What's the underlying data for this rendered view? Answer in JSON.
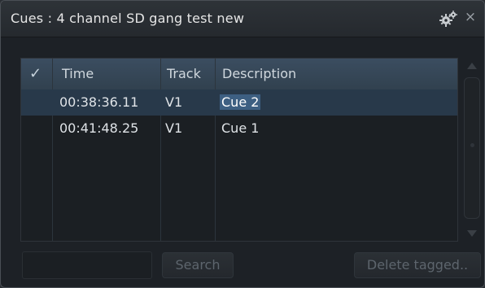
{
  "window": {
    "title": "Cues : 4 channel SD gang test new",
    "close_glyph": "×"
  },
  "table": {
    "columns": {
      "check": "✓",
      "time": "Time",
      "track": "Track",
      "description": "Description"
    },
    "rows": [
      {
        "time": "00:38:36.11",
        "track": "V1",
        "description": "Cue 2",
        "selected": true
      },
      {
        "time": "00:41:48.25",
        "track": "V1",
        "description": "Cue 1",
        "selected": false
      }
    ]
  },
  "footer": {
    "search_value": "",
    "search_button": "Search",
    "delete_button": "Delete tagged.."
  },
  "icons": {
    "settings": "gear-icon",
    "close": "close-icon",
    "scroll_up": "arrow-up-icon",
    "scroll_down": "arrow-down-icon"
  },
  "colors": {
    "header_bg": "#3b4d60",
    "selected_row": "#28394a",
    "highlight": "#3d5f82"
  }
}
